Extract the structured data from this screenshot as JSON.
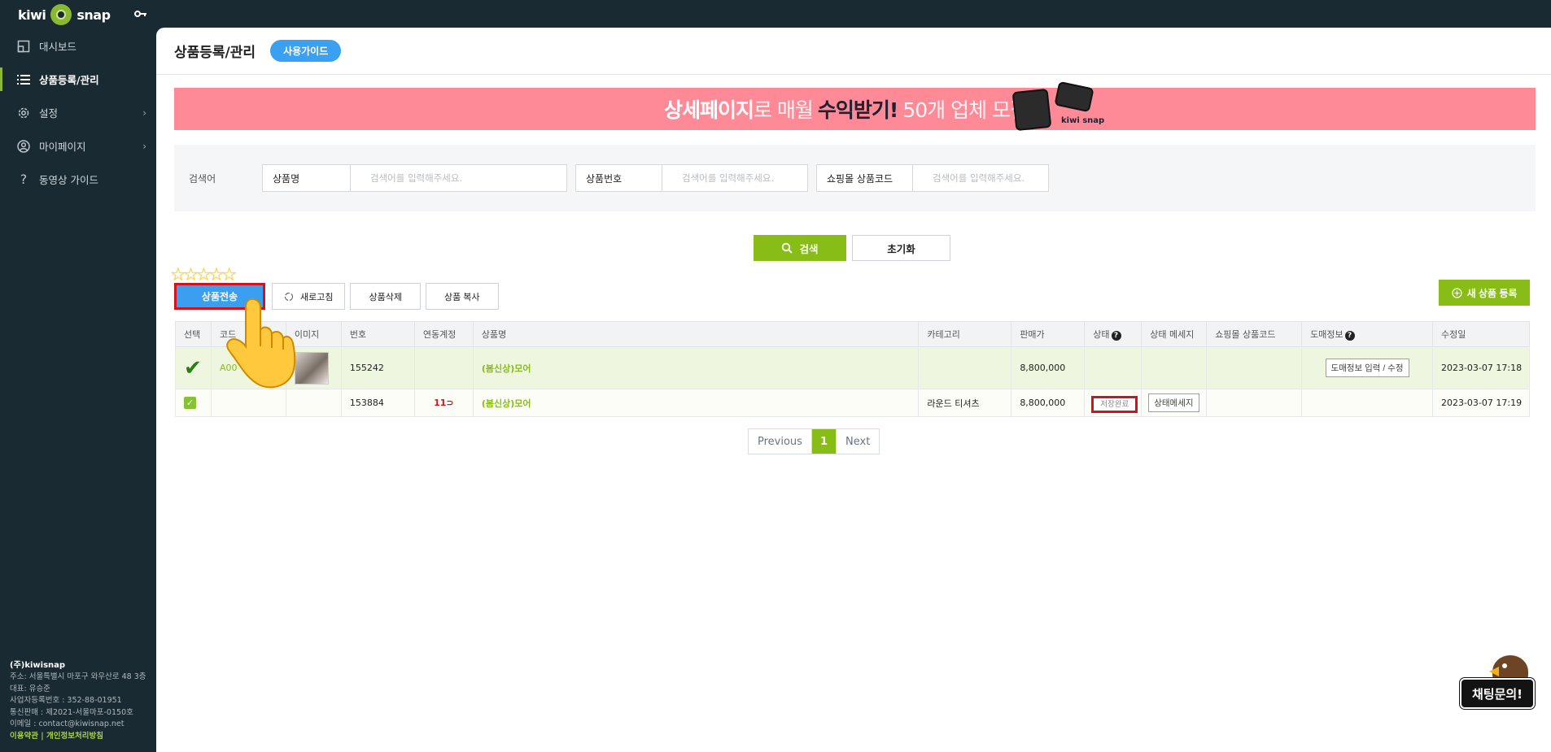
{
  "brand": {
    "logo_left": "kiwi",
    "logo_right": "snap"
  },
  "sidebar": {
    "items": [
      {
        "label": "대시보드",
        "icon": "dashboard-icon"
      },
      {
        "label": "상품등록/관리",
        "icon": "list-icon",
        "active": true
      },
      {
        "label": "설정",
        "icon": "gear-icon",
        "has_submenu": true
      },
      {
        "label": "마이페이지",
        "icon": "user-icon",
        "has_submenu": true
      },
      {
        "label": "동영상 가이드",
        "icon": "question-icon"
      }
    ],
    "company": {
      "name": "(주)kiwisnap",
      "address": "주소: 서울특별시 마포구 와우산로 48 3층",
      "ceo": "대표: 유승준",
      "biz_no": "사업자등록번호 : 352-88-01951",
      "mail_order": "통신판매 : 제2021-서울마포-0150호",
      "email": "이메일 : contact@kiwisnap.net",
      "links": "이용약관 | 개인정보처리방침"
    }
  },
  "header": {
    "title": "상품등록/관리",
    "guide_label": "사용가이드"
  },
  "banner": {
    "part1": "상세페이지",
    "part2": "로 매월",
    "part3": "수익받기!",
    "part4": "50개 업체 모집중",
    "logo": "kiwi snap"
  },
  "search": {
    "label": "검색어",
    "fields": [
      {
        "label": "상품명",
        "placeholder": "검색어를 입력해주세요."
      },
      {
        "label": "상품번호",
        "placeholder": "검색어를 입력해주세요."
      },
      {
        "label": "쇼핑몰 상품코드",
        "placeholder": "검색어를 입력해주세요."
      }
    ],
    "search_label": "검색",
    "reset_label": "초기화"
  },
  "toolbar": {
    "send_label": "상품전송",
    "refresh_label": "새로고침",
    "delete_label": "상품삭제",
    "copy_label": "상품 복사",
    "new_label": "새 상품 등록"
  },
  "table": {
    "headers": [
      "선택",
      "코드",
      "이미지",
      "번호",
      "연동계정",
      "상품명",
      "카테고리",
      "판매가",
      "상태",
      "상태 메세지",
      "쇼핑몰 상품코드",
      "도매정보",
      "수정일"
    ],
    "rows": [
      {
        "code": "A00",
        "number": "155242",
        "account": "",
        "name": "(봄신상)모어",
        "category": "",
        "price": "8,800,000",
        "status": "",
        "status_msg": "",
        "mall_code": "",
        "wholesale": "도매정보 입력 / 수정",
        "updated": "2023-03-07 17:18"
      },
      {
        "code": "",
        "number": "153884",
        "account": "11⊃",
        "name": "(봄신상)모어",
        "category": "라운드 티셔츠",
        "price": "8,800,000",
        "status": "저장완료",
        "status_msg": "상태메세지",
        "mall_code": "",
        "wholesale": "",
        "updated": "2023-03-07 17:19"
      }
    ]
  },
  "pagination": {
    "prev": "Previous",
    "current": "1",
    "next": "Next"
  },
  "chat": {
    "label": "채팅문의!"
  },
  "colors": {
    "accent": "#87bd16",
    "sidebar": "#1a2a33",
    "primary": "#3a9ff0",
    "banner": "#ff8a97"
  }
}
